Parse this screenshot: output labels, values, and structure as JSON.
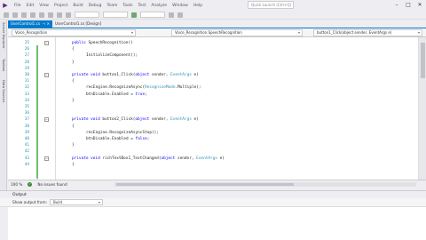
{
  "menubar": {
    "logo": "▶",
    "items": [
      "File",
      "Edit",
      "View",
      "Project",
      "Build",
      "Debug",
      "Team",
      "Tools",
      "Test",
      "Analyze",
      "Window",
      "Help"
    ],
    "quick_launch": "Quick Launch (Ctrl+Q)"
  },
  "tabs": [
    {
      "label": "UserControl1.cs",
      "active": true
    },
    {
      "label": "UserControl1.cs [Design]",
      "active": false
    }
  ],
  "side_tabs": [
    "Server Explorer",
    "Toolbox",
    "Data Sources"
  ],
  "navbar": {
    "project": "Voice_Recognition",
    "class": "Voice_Recognition.SpeechRecognition",
    "member": "button1_Click(object sender, EventArgs e)"
  },
  "code_lines": [
    {
      "num": "25",
      "indent": 0,
      "tokens": [
        [
          "kw",
          "public "
        ],
        [
          "",
          "SpeechRecognition()"
        ]
      ],
      "fold": "-"
    },
    {
      "num": "26",
      "indent": 0,
      "tokens": [
        [
          "",
          "{"
        ]
      ]
    },
    {
      "num": "27",
      "indent": 1,
      "tokens": [
        [
          "",
          "InitializeComponent();"
        ]
      ]
    },
    {
      "num": "28",
      "indent": 0,
      "tokens": [
        [
          "",
          "}"
        ]
      ]
    },
    {
      "num": "29",
      "indent": 0,
      "tokens": []
    },
    {
      "num": "30",
      "indent": 0,
      "tokens": [
        [
          "kw",
          "private void "
        ],
        [
          "",
          "button1_Click("
        ],
        [
          "kw",
          "object "
        ],
        [
          "",
          "sender, "
        ],
        [
          "ty",
          "EventArgs "
        ],
        [
          "",
          "e)"
        ]
      ],
      "fold": "-"
    },
    {
      "num": "31",
      "indent": 0,
      "tokens": [
        [
          "",
          "{"
        ]
      ]
    },
    {
      "num": "32",
      "indent": 1,
      "tokens": [
        [
          "",
          "recEngine.RecognizeAsync("
        ],
        [
          "ty",
          "RecognizeMode"
        ],
        [
          "",
          ".Multiple);"
        ]
      ]
    },
    {
      "num": "33",
      "indent": 1,
      "tokens": [
        [
          "",
          "btnDisable.Enabled = "
        ],
        [
          "kw",
          "true"
        ],
        [
          "",
          ";"
        ]
      ]
    },
    {
      "num": "34",
      "indent": 0,
      "tokens": [
        [
          "",
          "}"
        ]
      ]
    },
    {
      "num": "35",
      "indent": 0,
      "tokens": []
    },
    {
      "num": "36",
      "indent": 0,
      "tokens": []
    },
    {
      "num": "37",
      "indent": 0,
      "tokens": [
        [
          "kw",
          "private void "
        ],
        [
          "",
          "button2_Click("
        ],
        [
          "kw",
          "object "
        ],
        [
          "",
          "sender, "
        ],
        [
          "ty",
          "EventArgs "
        ],
        [
          "",
          "e)"
        ]
      ],
      "fold": "-"
    },
    {
      "num": "38",
      "indent": 0,
      "tokens": [
        [
          "",
          "{"
        ]
      ]
    },
    {
      "num": "39",
      "indent": 1,
      "tokens": [
        [
          "",
          "recEngine.RecognizeAsyncStop();"
        ]
      ]
    },
    {
      "num": "40",
      "indent": 1,
      "tokens": [
        [
          "",
          "btnDisable.Enabled = "
        ],
        [
          "kw",
          "false"
        ],
        [
          "",
          ";"
        ]
      ]
    },
    {
      "num": "41",
      "indent": 0,
      "tokens": [
        [
          "",
          "}"
        ]
      ]
    },
    {
      "num": "42",
      "indent": 0,
      "tokens": []
    },
    {
      "num": "43",
      "indent": 0,
      "tokens": [
        [
          "kw",
          "private void "
        ],
        [
          "",
          "richTextBox1_TextChanged("
        ],
        [
          "kw",
          "object "
        ],
        [
          "",
          "sender, "
        ],
        [
          "ty",
          "EventArgs "
        ],
        [
          "",
          "e)"
        ]
      ],
      "fold": "-"
    },
    {
      "num": "44",
      "indent": 0,
      "tokens": [
        [
          "",
          "{"
        ]
      ]
    }
  ],
  "status": {
    "zoom": "100 %",
    "issues": "No issues found"
  },
  "output": {
    "title": "Output",
    "show_from_label": "Show output from:",
    "show_from_value": "Build"
  }
}
